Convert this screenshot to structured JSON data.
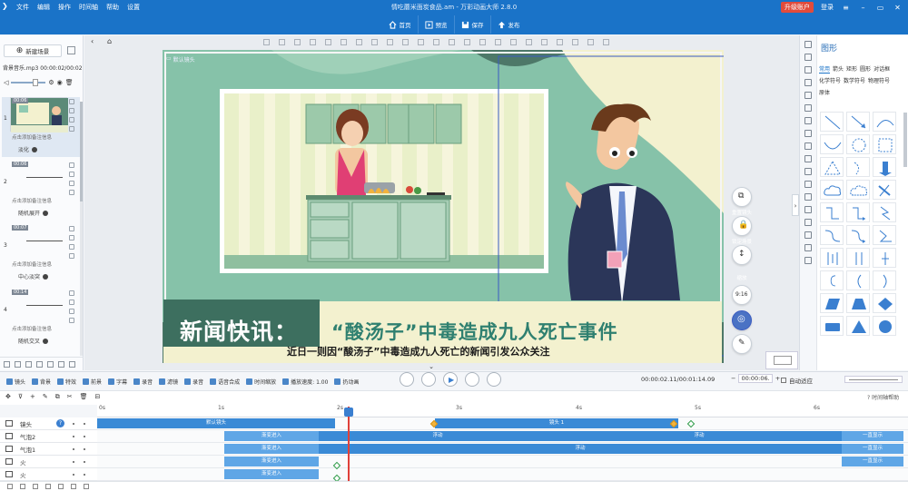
{
  "menu": [
    "文件",
    "编辑",
    "操作",
    "时间轴",
    "帮助",
    "设置"
  ],
  "app_title": "情吃蘑米面炭食品.am - 万彩动画大师 2.8.0",
  "upgrade_label": "升级账户",
  "login_label": "登录",
  "quickbar": [
    {
      "label": "首页",
      "icon": "home-icon"
    },
    {
      "label": "预览",
      "icon": "preview-icon"
    },
    {
      "label": "保存",
      "icon": "save-icon"
    },
    {
      "label": "发布",
      "icon": "publish-icon"
    }
  ],
  "left": {
    "new_scene": "新建场景",
    "music": "背景音乐.mp3  00:00:02/00:02:44",
    "scenes": [
      {
        "num": "1",
        "duration": "00:06",
        "note": "点击添加备注信息",
        "transition": "淡化"
      },
      {
        "num": "2",
        "duration": "00:06",
        "note": "点击添加备注信息",
        "transition": "随机展开"
      },
      {
        "num": "3",
        "duration": "00:07",
        "note": "点击添加备注信息",
        "transition": "中心淡突"
      },
      {
        "num": "4",
        "duration": "00:14",
        "note": "点击添加备注信息",
        "transition": "随机交叉"
      }
    ]
  },
  "stage": {
    "camera_label": "默认镜头",
    "headline_a": "新闻快讯：",
    "headline_b": "“酸汤子”中毒造成九人死亡事件",
    "subtitle": "近日一则因“酸汤子”中毒造成九人死亡的新闻引发公众关注",
    "tools": [
      {
        "label": "重置镜头",
        "icon": "reset-camera-icon"
      },
      {
        "label": "锁定场景",
        "icon": "lock-scene-icon"
      },
      {
        "label": "缩放",
        "icon": "zoom-icon"
      },
      {
        "label": "9:16",
        "icon": ""
      },
      {
        "label": "",
        "icon": "globe-icon"
      },
      {
        "label": "",
        "icon": "edit-icon"
      }
    ],
    "colors": {
      "bg": "#4d7868",
      "light": "#f3f1cf",
      "mint": "#8fc9b1",
      "dark_green": "#3d6f5f",
      "headline_teal": "#2f8070"
    }
  },
  "right": {
    "title": "图形",
    "categories": [
      "常用",
      "箭头",
      "矩形",
      "圆形",
      "对话框",
      "化学符号",
      "数学符号",
      "物理符号",
      "原体"
    ],
    "shapes": [
      "line",
      "arrow-line",
      "arc",
      "curve",
      "dashed-circle",
      "dashed-square",
      "dashed-triangle",
      "arrow-curve",
      "arrow-down",
      "cloud",
      "cloud-outline",
      "thick-arrow",
      "step-line",
      "step-arrow",
      "zigzag",
      "s-curve",
      "s-arrow",
      "s-line",
      "bracket-bar",
      "bracket-pipe",
      "bracket-x",
      "brace-left",
      "paren",
      "brace-right",
      "parallelogram",
      "trapezoid",
      "diamond",
      "rectangle",
      "triangle",
      "circle"
    ]
  },
  "timeline": {
    "tools": [
      "镜头",
      "背景",
      "特效",
      "前景",
      "字幕",
      "录音",
      "滤镜",
      "录音",
      "语音合成",
      "时间缩放",
      "播放速度: 1.00",
      "扔动画"
    ],
    "time": "00:00:02.11/00:01:14.09",
    "zoom": "00:00:06.",
    "auto_fit": "自动适应",
    "help": "时间轴帮助",
    "ticks": [
      "0s",
      "1s",
      "2s",
      "3s",
      "4s",
      "5s",
      "6s"
    ],
    "tracks": [
      {
        "name": "镜头",
        "icon": "camera-icon"
      },
      {
        "name": "气泡2",
        "icon": "image-icon"
      },
      {
        "name": "气泡1",
        "icon": "image-icon"
      },
      {
        "name": "火",
        "icon": "fire-icon"
      },
      {
        "name": "火",
        "icon": "fire-icon"
      }
    ],
    "bars": [
      {
        "row": 0,
        "label": "默认镜头"
      },
      {
        "row": 0,
        "label": "镜头 1"
      },
      {
        "row": 1,
        "label": "渐变进入"
      },
      {
        "row": 1,
        "label": "浮动"
      },
      {
        "row": 1,
        "label": "浮动"
      },
      {
        "row": 1,
        "label": "一直显示"
      },
      {
        "row": 2,
        "label": "渐变进入"
      },
      {
        "row": 2,
        "label": "浮动"
      },
      {
        "row": 2,
        "label": "一直显示"
      },
      {
        "row": 3,
        "label": "渐变进入"
      },
      {
        "row": 3,
        "label": "一直显示"
      },
      {
        "row": 4,
        "label": "渐变进入"
      }
    ]
  }
}
